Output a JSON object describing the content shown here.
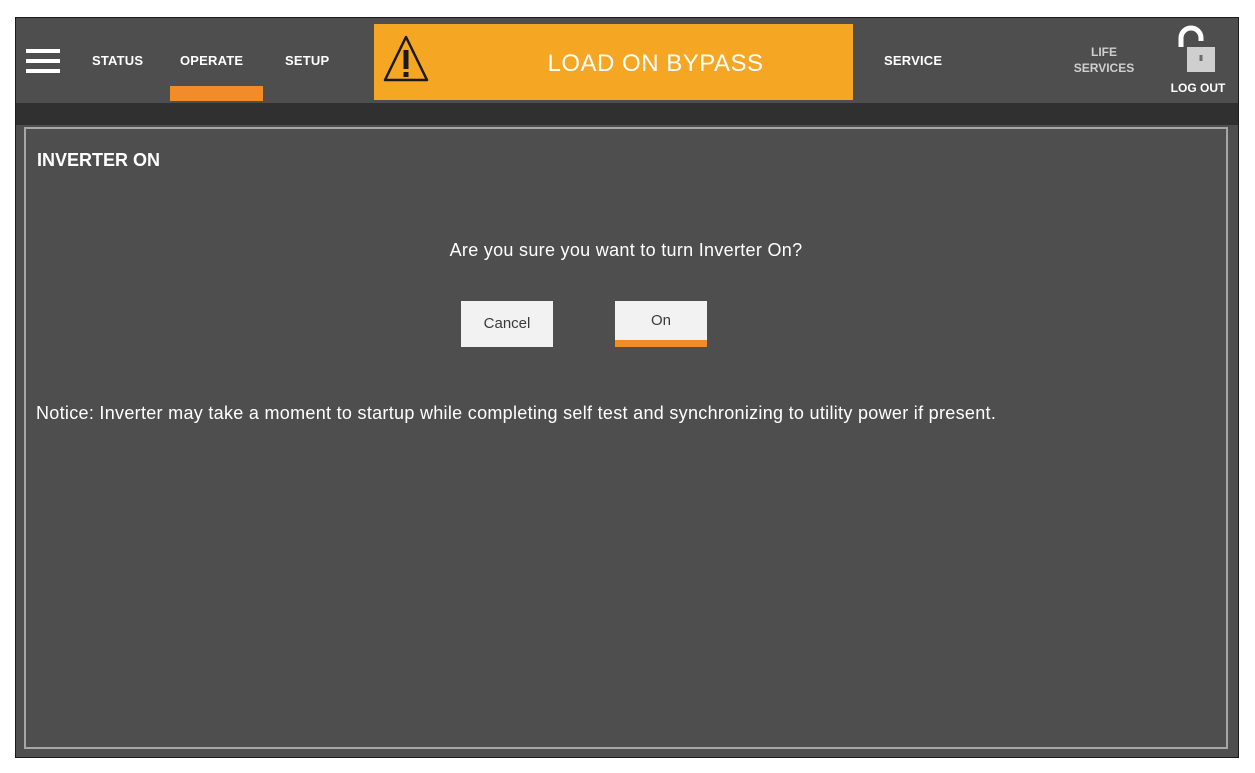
{
  "nav": {
    "items": [
      {
        "label": "STATUS"
      },
      {
        "label": "OPERATE",
        "active": true
      },
      {
        "label": "SETUP"
      }
    ],
    "service": "SERVICE",
    "life_services": "LIFE SERVICES",
    "life_line1": "LIFE",
    "life_line2": "SERVICES",
    "logout": "LOG OUT",
    "icons": {
      "menu": "hamburger-menu-icon",
      "alarm": "warning-triangle-icon",
      "logout": "unlocked-padlock-icon"
    }
  },
  "alarm": {
    "text": "LOAD ON BYPASS",
    "color": "#f5a623"
  },
  "dialog": {
    "title": "INVERTER ON",
    "question": "Are you sure you want to turn Inverter On?",
    "cancel_label": "Cancel",
    "confirm_label": "On",
    "notice": "Notice: Inverter may take a moment to startup while completing self test and synchronizing to utility power if present."
  },
  "colors": {
    "accent": "#f28c28",
    "background": "#4d4e4d",
    "panel_border": "#a6a6a6"
  }
}
